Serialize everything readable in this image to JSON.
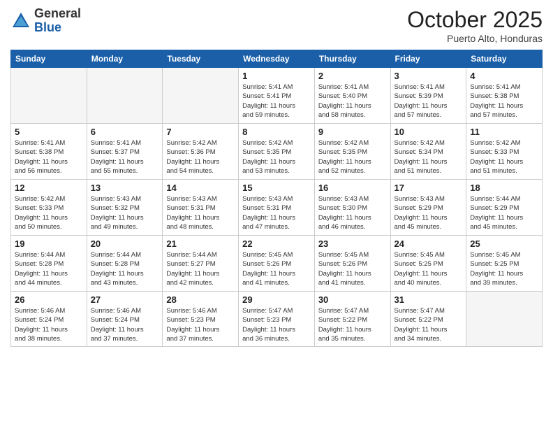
{
  "logo": {
    "general": "General",
    "blue": "Blue"
  },
  "header": {
    "month": "October 2025",
    "location": "Puerto Alto, Honduras"
  },
  "days_of_week": [
    "Sunday",
    "Monday",
    "Tuesday",
    "Wednesday",
    "Thursday",
    "Friday",
    "Saturday"
  ],
  "weeks": [
    [
      {
        "day": "",
        "info": ""
      },
      {
        "day": "",
        "info": ""
      },
      {
        "day": "",
        "info": ""
      },
      {
        "day": "1",
        "info": "Sunrise: 5:41 AM\nSunset: 5:41 PM\nDaylight: 11 hours\nand 59 minutes."
      },
      {
        "day": "2",
        "info": "Sunrise: 5:41 AM\nSunset: 5:40 PM\nDaylight: 11 hours\nand 58 minutes."
      },
      {
        "day": "3",
        "info": "Sunrise: 5:41 AM\nSunset: 5:39 PM\nDaylight: 11 hours\nand 57 minutes."
      },
      {
        "day": "4",
        "info": "Sunrise: 5:41 AM\nSunset: 5:38 PM\nDaylight: 11 hours\nand 57 minutes."
      }
    ],
    [
      {
        "day": "5",
        "info": "Sunrise: 5:41 AM\nSunset: 5:38 PM\nDaylight: 11 hours\nand 56 minutes."
      },
      {
        "day": "6",
        "info": "Sunrise: 5:41 AM\nSunset: 5:37 PM\nDaylight: 11 hours\nand 55 minutes."
      },
      {
        "day": "7",
        "info": "Sunrise: 5:42 AM\nSunset: 5:36 PM\nDaylight: 11 hours\nand 54 minutes."
      },
      {
        "day": "8",
        "info": "Sunrise: 5:42 AM\nSunset: 5:35 PM\nDaylight: 11 hours\nand 53 minutes."
      },
      {
        "day": "9",
        "info": "Sunrise: 5:42 AM\nSunset: 5:35 PM\nDaylight: 11 hours\nand 52 minutes."
      },
      {
        "day": "10",
        "info": "Sunrise: 5:42 AM\nSunset: 5:34 PM\nDaylight: 11 hours\nand 51 minutes."
      },
      {
        "day": "11",
        "info": "Sunrise: 5:42 AM\nSunset: 5:33 PM\nDaylight: 11 hours\nand 51 minutes."
      }
    ],
    [
      {
        "day": "12",
        "info": "Sunrise: 5:42 AM\nSunset: 5:33 PM\nDaylight: 11 hours\nand 50 minutes."
      },
      {
        "day": "13",
        "info": "Sunrise: 5:43 AM\nSunset: 5:32 PM\nDaylight: 11 hours\nand 49 minutes."
      },
      {
        "day": "14",
        "info": "Sunrise: 5:43 AM\nSunset: 5:31 PM\nDaylight: 11 hours\nand 48 minutes."
      },
      {
        "day": "15",
        "info": "Sunrise: 5:43 AM\nSunset: 5:31 PM\nDaylight: 11 hours\nand 47 minutes."
      },
      {
        "day": "16",
        "info": "Sunrise: 5:43 AM\nSunset: 5:30 PM\nDaylight: 11 hours\nand 46 minutes."
      },
      {
        "day": "17",
        "info": "Sunrise: 5:43 AM\nSunset: 5:29 PM\nDaylight: 11 hours\nand 45 minutes."
      },
      {
        "day": "18",
        "info": "Sunrise: 5:44 AM\nSunset: 5:29 PM\nDaylight: 11 hours\nand 45 minutes."
      }
    ],
    [
      {
        "day": "19",
        "info": "Sunrise: 5:44 AM\nSunset: 5:28 PM\nDaylight: 11 hours\nand 44 minutes."
      },
      {
        "day": "20",
        "info": "Sunrise: 5:44 AM\nSunset: 5:28 PM\nDaylight: 11 hours\nand 43 minutes."
      },
      {
        "day": "21",
        "info": "Sunrise: 5:44 AM\nSunset: 5:27 PM\nDaylight: 11 hours\nand 42 minutes."
      },
      {
        "day": "22",
        "info": "Sunrise: 5:45 AM\nSunset: 5:26 PM\nDaylight: 11 hours\nand 41 minutes."
      },
      {
        "day": "23",
        "info": "Sunrise: 5:45 AM\nSunset: 5:26 PM\nDaylight: 11 hours\nand 41 minutes."
      },
      {
        "day": "24",
        "info": "Sunrise: 5:45 AM\nSunset: 5:25 PM\nDaylight: 11 hours\nand 40 minutes."
      },
      {
        "day": "25",
        "info": "Sunrise: 5:45 AM\nSunset: 5:25 PM\nDaylight: 11 hours\nand 39 minutes."
      }
    ],
    [
      {
        "day": "26",
        "info": "Sunrise: 5:46 AM\nSunset: 5:24 PM\nDaylight: 11 hours\nand 38 minutes."
      },
      {
        "day": "27",
        "info": "Sunrise: 5:46 AM\nSunset: 5:24 PM\nDaylight: 11 hours\nand 37 minutes."
      },
      {
        "day": "28",
        "info": "Sunrise: 5:46 AM\nSunset: 5:23 PM\nDaylight: 11 hours\nand 37 minutes."
      },
      {
        "day": "29",
        "info": "Sunrise: 5:47 AM\nSunset: 5:23 PM\nDaylight: 11 hours\nand 36 minutes."
      },
      {
        "day": "30",
        "info": "Sunrise: 5:47 AM\nSunset: 5:22 PM\nDaylight: 11 hours\nand 35 minutes."
      },
      {
        "day": "31",
        "info": "Sunrise: 5:47 AM\nSunset: 5:22 PM\nDaylight: 11 hours\nand 34 minutes."
      },
      {
        "day": "",
        "info": ""
      }
    ]
  ]
}
